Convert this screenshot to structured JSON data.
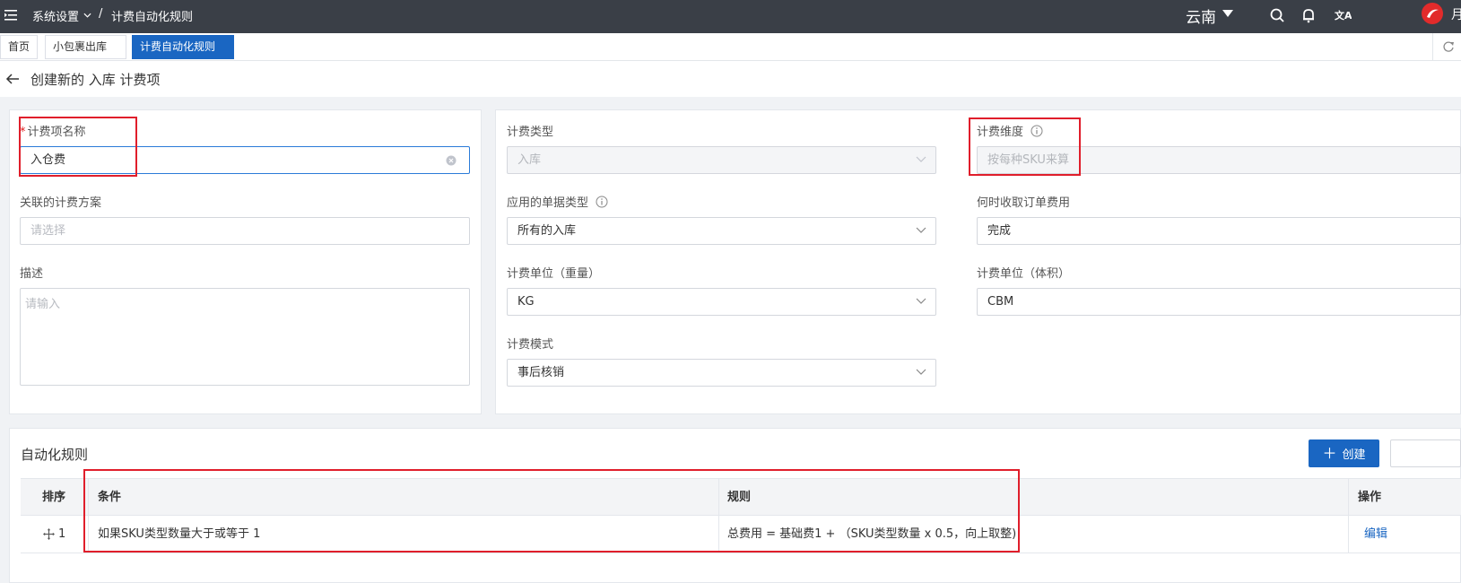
{
  "topbar": {
    "breadcrumb_parent": "系统设置",
    "breadcrumb_separator": "/",
    "breadcrumb_current": "计费自动化规则",
    "region": "云南",
    "user_initial": "月"
  },
  "tabs": [
    {
      "label": "首页"
    },
    {
      "label": "小包裹出库"
    },
    {
      "label": "计费自动化规则",
      "close": "×"
    }
  ],
  "page": {
    "title": "创建新的 入库 计费项"
  },
  "form": {
    "name_required_mark": "*",
    "name_label": "计费项名称",
    "name_value": "入仓费",
    "plan_label": "关联的计费方案",
    "plan_placeholder": "请选择",
    "desc_label": "描述",
    "desc_placeholder": "请输入",
    "type_label": "计费类型",
    "type_value": "入库",
    "doc_type_label": "应用的单据类型",
    "doc_type_value": "所有的入库",
    "weight_unit_label": "计费单位（重量）",
    "weight_unit_value": "KG",
    "mode_label": "计费模式",
    "mode_value": "事后核销",
    "dimension_label": "计费维度",
    "dimension_value": "按每种SKU来算",
    "charge_time_label": "何时收取订单费用",
    "charge_time_value": "完成",
    "volume_unit_label": "计费单位（体积）",
    "volume_unit_value": "CBM"
  },
  "rules": {
    "section_title": "自动化规则",
    "create_plus": "＋",
    "create_label": "创建",
    "headers": {
      "order": "排序",
      "condition": "条件",
      "rule": "规则",
      "actions": "操作"
    },
    "rows": [
      {
        "order": "1",
        "condition": "如果SKU类型数量大于或等于 1",
        "rule": "总费用 = 基础费1 + （SKU类型数量 x 0.5，向上取整)",
        "action": "编辑"
      }
    ]
  },
  "colors": {
    "topbar": "#3a3f47",
    "primary": "#1a66c2",
    "highlight": "#e01e2b"
  }
}
